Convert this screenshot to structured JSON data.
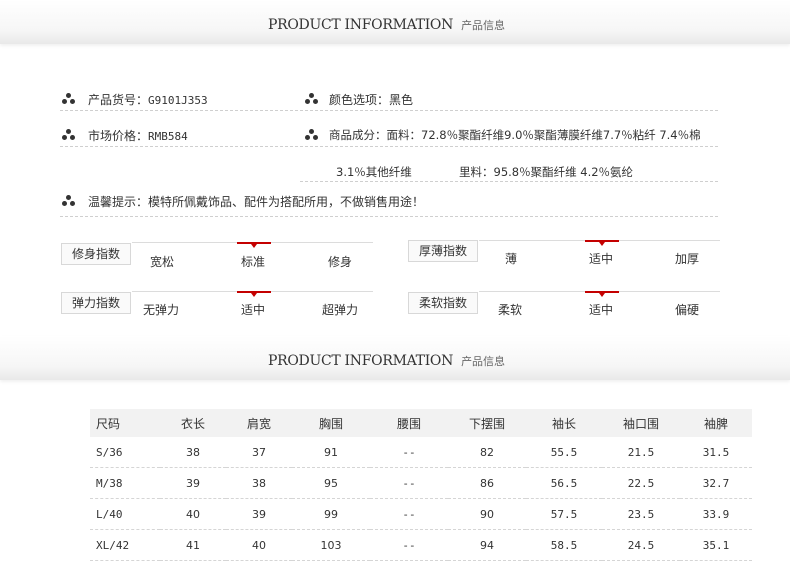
{
  "header1": {
    "title": "PRODUCT INFORMATION",
    "sub": "产品信息"
  },
  "info": {
    "code_label": "产品货号：",
    "code_value": "G9101J353",
    "color_label": "颜色选项：",
    "color_value": "黑色",
    "price_label": "市场价格：",
    "price_value": "RMB584",
    "comp_label": "商品成分：",
    "comp_line1": "面料：72.8％聚酯纤维9.0％聚酯薄膜纤维7.7％粘纤 7.4％棉",
    "comp_line2a": "3.1％其他纤维",
    "comp_line2b": "里料：95.8％聚酯纤维 4.2％氨纶",
    "tip_label": "温馨提示：",
    "tip_value": "模特所佩戴饰品、配件为搭配所用，不做销售用途！"
  },
  "scales": [
    {
      "label": "修身指数",
      "options": [
        "宽松",
        "标准",
        "修身"
      ],
      "selected": 1
    },
    {
      "label": "厚薄指数",
      "options": [
        "薄",
        "适中",
        "加厚"
      ],
      "selected": 1
    },
    {
      "label": "弹力指数",
      "options": [
        "无弹力",
        "适中",
        "超弹力"
      ],
      "selected": 1
    },
    {
      "label": "柔软指数",
      "options": [
        "柔软",
        "适中",
        "偏硬"
      ],
      "selected": 1
    }
  ],
  "header2": {
    "title": "PRODUCT INFORMATION",
    "sub": "产品信息"
  },
  "size_table": {
    "headers": [
      "尺码",
      "衣长",
      "肩宽",
      "胸围",
      "腰围",
      "下摆围",
      "袖长",
      "袖口围",
      "袖脾"
    ],
    "rows": [
      [
        "S/36",
        "38",
        "37",
        "91",
        "--",
        "82",
        "55.5",
        "21.5",
        "31.5"
      ],
      [
        "M/38",
        "39",
        "38",
        "95",
        "--",
        "86",
        "56.5",
        "22.5",
        "32.7"
      ],
      [
        "L/40",
        "40",
        "39",
        "99",
        "--",
        "90",
        "57.5",
        "23.5",
        "33.9"
      ],
      [
        "XL/42",
        "41",
        "40",
        "103",
        "--",
        "94",
        "58.5",
        "24.5",
        "35.1"
      ]
    ]
  }
}
